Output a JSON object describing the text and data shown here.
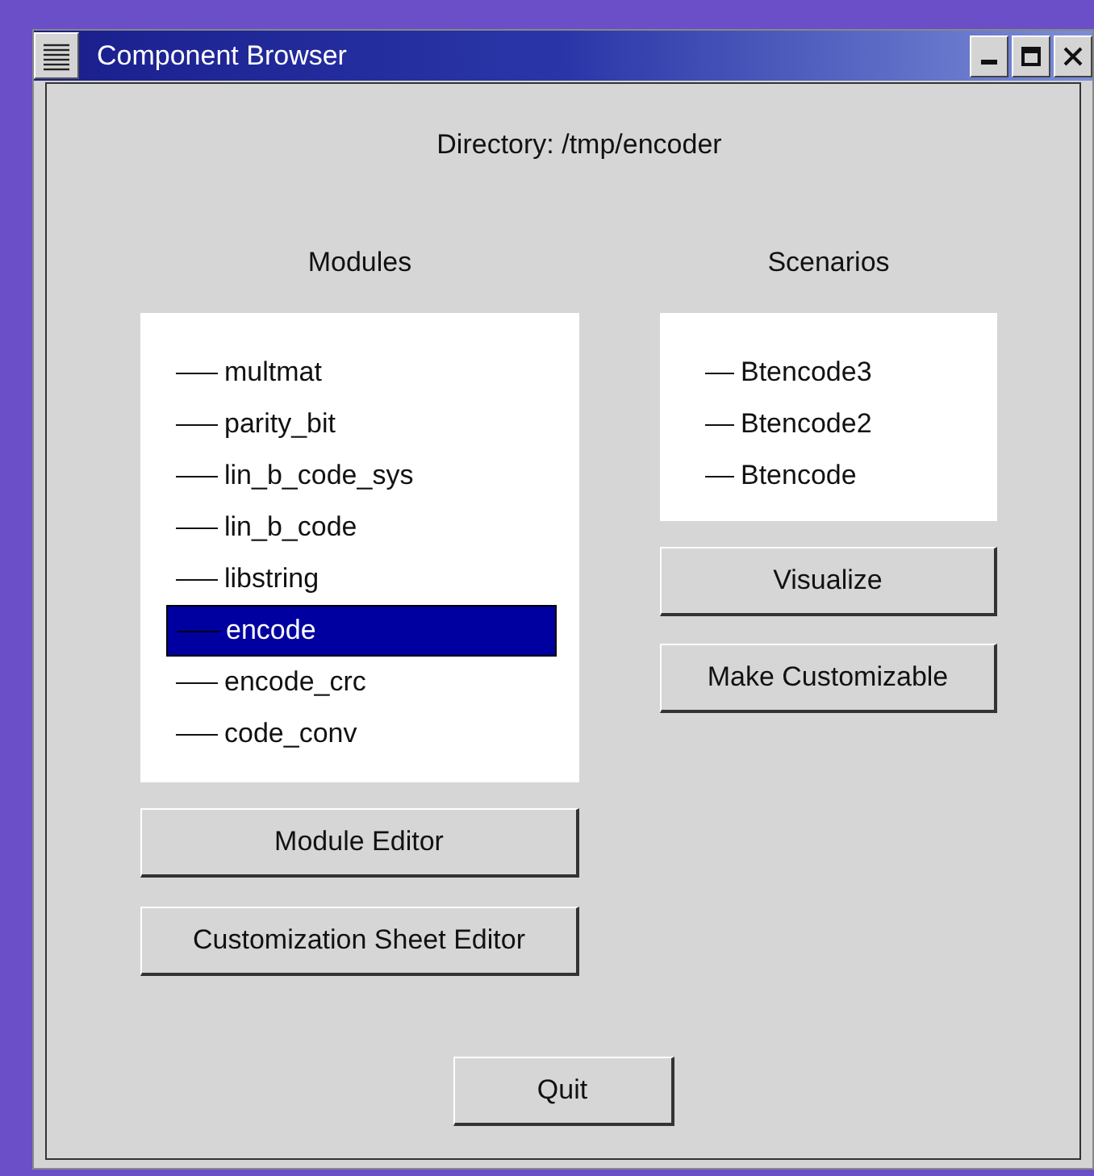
{
  "window": {
    "title": "Component Browser"
  },
  "directory": "Directory: /tmp/encoder",
  "modules": {
    "heading": "Modules",
    "items": [
      {
        "label": "multmat",
        "selected": false
      },
      {
        "label": "parity_bit",
        "selected": false
      },
      {
        "label": "lin_b_code_sys",
        "selected": false
      },
      {
        "label": "lin_b_code",
        "selected": false
      },
      {
        "label": "libstring",
        "selected": false
      },
      {
        "label": "encode",
        "selected": true
      },
      {
        "label": "encode_crc",
        "selected": false
      },
      {
        "label": "code_conv",
        "selected": false
      }
    ],
    "buttons": [
      "Module Editor",
      "Customization Sheet Editor"
    ]
  },
  "scenarios": {
    "heading": "Scenarios",
    "items": [
      {
        "label": "Btencode3",
        "selected": false
      },
      {
        "label": "Btencode2",
        "selected": false
      },
      {
        "label": "Btencode",
        "selected": false
      }
    ],
    "buttons": [
      "Visualize",
      "Make Customizable"
    ]
  },
  "quit": "Quit"
}
